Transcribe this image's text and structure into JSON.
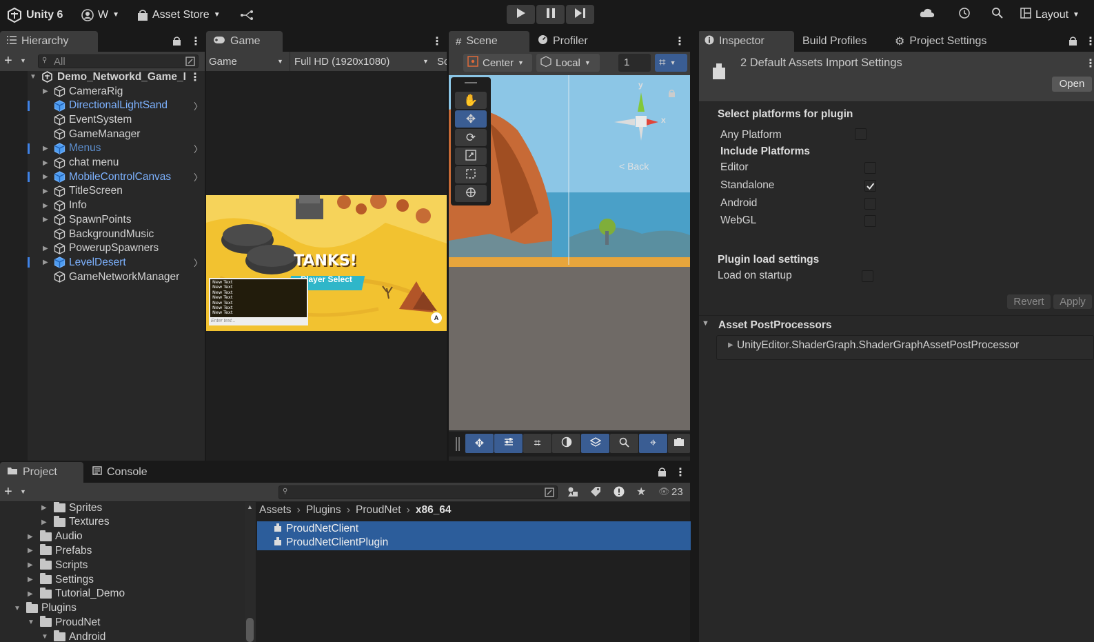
{
  "topbar": {
    "app_title": "Unity 6",
    "account": "W",
    "asset_store": "Asset Store",
    "layout": "Layout"
  },
  "hierarchy": {
    "tab": "Hierarchy",
    "search_placeholder": "All",
    "scene_name": "Demo_Networkd_Game_I",
    "items": [
      {
        "label": "CameraRig",
        "expand": true,
        "prefab": false
      },
      {
        "label": "DirectionalLightSand",
        "expand": false,
        "prefab": true
      },
      {
        "label": "EventSystem",
        "expand": false,
        "prefab": false
      },
      {
        "label": "GameManager",
        "expand": false,
        "prefab": false
      },
      {
        "label": "Menus",
        "expand": true,
        "prefab": true
      },
      {
        "label": "chat menu",
        "expand": true,
        "prefab": false
      },
      {
        "label": "MobileControlCanvas",
        "expand": true,
        "prefab": true
      },
      {
        "label": "TitleScreen",
        "expand": true,
        "prefab": false
      },
      {
        "label": "Info",
        "expand": true,
        "prefab": false
      },
      {
        "label": "SpawnPoints",
        "expand": true,
        "prefab": false
      },
      {
        "label": "BackgroundMusic",
        "expand": false,
        "prefab": false
      },
      {
        "label": "PowerupSpawners",
        "expand": true,
        "prefab": false
      },
      {
        "label": "LevelDesert",
        "expand": true,
        "prefab": true
      },
      {
        "label": "GameNetworkManager",
        "expand": false,
        "prefab": false
      }
    ]
  },
  "game": {
    "tab": "Game",
    "display": "Game",
    "resolution": "Full HD (1920x1080)",
    "extra": "Sc",
    "title": "TANKS!",
    "subtitle": "Player Select",
    "chat_lines": [
      "New Text",
      "New Text",
      "New Text",
      "New Text",
      "New Text",
      "New Text",
      "New Text"
    ],
    "chat_placeholder": "Enter text...",
    "badge": "A"
  },
  "scene": {
    "tab": "Scene",
    "profiler_tab": "Profiler",
    "pivot": "Center",
    "space": "Local",
    "snap_value": "1",
    "gizmo_y": "y",
    "gizmo_x": "x",
    "back": "< Back"
  },
  "inspector": {
    "tab": "Inspector",
    "build_profiles": "Build Profiles",
    "project_settings": "Project Settings",
    "header": "2 Default Assets Import Settings",
    "open_btn": "Open",
    "select_platforms": "Select platforms for plugin",
    "any_platform": "Any Platform",
    "include_platforms": "Include Platforms",
    "platforms": [
      {
        "label": "Editor",
        "checked": false
      },
      {
        "label": "Standalone",
        "checked": true
      },
      {
        "label": "Android",
        "checked": false
      },
      {
        "label": "WebGL",
        "checked": false
      }
    ],
    "load_settings": "Plugin load settings",
    "load_on_startup": "Load on startup",
    "revert": "Revert",
    "apply": "Apply",
    "postprocessors": "Asset PostProcessors",
    "postprocessor_item": "UnityEditor.ShaderGraph.ShaderGraphAssetPostProcessor"
  },
  "project": {
    "tab": "Project",
    "console_tab": "Console",
    "badge_count": "23",
    "tree": [
      {
        "label": "Sprites",
        "level": 2,
        "expand": "right"
      },
      {
        "label": "Textures",
        "level": 2,
        "expand": "right"
      },
      {
        "label": "Audio",
        "level": 1,
        "expand": "right"
      },
      {
        "label": "Prefabs",
        "level": 1,
        "expand": "right"
      },
      {
        "label": "Scripts",
        "level": 1,
        "expand": "right"
      },
      {
        "label": "Settings",
        "level": 1,
        "expand": "right"
      },
      {
        "label": "Tutorial_Demo",
        "level": 1,
        "expand": "right"
      },
      {
        "label": "Plugins",
        "level": 0,
        "expand": "down"
      },
      {
        "label": "ProudNet",
        "level": 1,
        "expand": "down"
      },
      {
        "label": "Android",
        "level": 2,
        "expand": "down"
      }
    ],
    "breadcrumb": [
      "Assets",
      "Plugins",
      "ProudNet",
      "x86_64"
    ],
    "files": [
      "ProudNetClient",
      "ProudNetClientPlugin"
    ]
  }
}
